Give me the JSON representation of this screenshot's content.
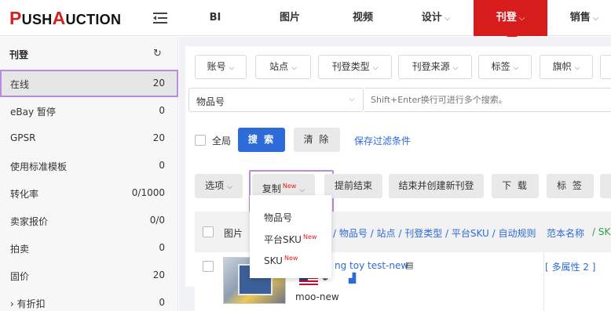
{
  "brand": {
    "logo_p": "P",
    "logo_ush": "USH",
    "logo_a": "A",
    "logo_rest": "UCTION",
    "accent_color": "#d71c1c",
    "primary_color": "#2d6bd8"
  },
  "topnav": {
    "items": [
      {
        "label": "BI",
        "chevron": ""
      },
      {
        "label": "图片",
        "chevron": ""
      },
      {
        "label": "视频",
        "chevron": ""
      },
      {
        "label": "设计",
        "chevron": "⌵"
      },
      {
        "label": "刊登",
        "chevron": "⌵"
      },
      {
        "label": "销售",
        "chevron": "⌵"
      }
    ],
    "active": "刊登"
  },
  "sidebar": {
    "title": "刊登",
    "refresh_icon": "↻",
    "items": [
      {
        "label": "在线",
        "count": "20",
        "active": true
      },
      {
        "label": "eBay 暂停",
        "count": "0"
      },
      {
        "label": "GPSR",
        "count": "20"
      },
      {
        "label": "使用标准模板",
        "count": "0"
      },
      {
        "label": "转化率",
        "count": "0/1000"
      },
      {
        "label": "卖家报价",
        "count": "0/0"
      },
      {
        "label": "拍卖",
        "count": "0"
      },
      {
        "label": "固价",
        "count": "20"
      },
      {
        "label": "› 有折扣",
        "count": "0"
      }
    ]
  },
  "filters": {
    "buttons": [
      "账号",
      "站点",
      "刊登类型",
      "刊登来源",
      "标签",
      "旗帜"
    ],
    "field_select": "物品号",
    "search_placeholder": "Shift+Enter换行可进行多个搜索。",
    "select_all": "全局",
    "search_btn": "搜 索",
    "clear_btn": "清 除",
    "save_filter": "保存过滤条件"
  },
  "actions": {
    "options": "选项",
    "copy": "复制",
    "new_tag": "New",
    "end_early": "提前结束",
    "end_and_relist": "结束并创建新刊登",
    "download": "下 载",
    "tag": "标 签"
  },
  "copy_menu": {
    "items": [
      {
        "label": "物品号",
        "new": ""
      },
      {
        "label": "平台SKU",
        "new": "New"
      },
      {
        "label": "SKU",
        "new": "New"
      }
    ]
  },
  "table": {
    "header_image": "图片",
    "header_info": "/ 物品号 / 站点 / 刊登类型 / 平台SKU / 自动规则",
    "header_template": "范本名称",
    "header_sku": "/ SKU"
  },
  "rows": [
    {
      "title": "ng toy test-new",
      "seller": "moo-new",
      "variation": "[ 多属性 2 ]"
    }
  ]
}
